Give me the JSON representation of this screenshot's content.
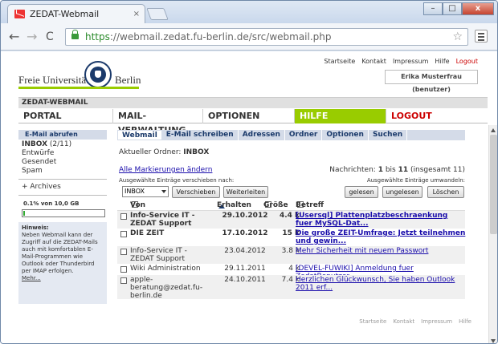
{
  "browser": {
    "tab_title": "ZEDAT-Webmail",
    "tab_close": "×",
    "url_https": "https",
    "url_rest": "://webmail.zedat.fu-berlin.de/src/webmail.php",
    "back": "←",
    "forward": "→",
    "reload": "C",
    "star": "☆",
    "min": "–",
    "max": "□",
    "close": "x"
  },
  "header": {
    "uni_left": "Freie Universität",
    "uni_right": "Berlin",
    "links": [
      "Startseite",
      "Kontakt",
      "Impressum",
      "Hilfe"
    ],
    "logout": "Logout",
    "user": "Erika Musterfrau (benutzer)",
    "strip": "ZEDAT-WEBMAIL"
  },
  "mainnav": [
    "PORTAL",
    "MAIL-VERWALTUNG",
    "OPTIONEN",
    "HILFE",
    "LOGOUT"
  ],
  "sidebar": {
    "head": "E-Mail abrufen",
    "inbox": "INBOX",
    "inbox_count": "(2/11)",
    "items": [
      "Entwürfe",
      "Gesendet",
      "Spam"
    ],
    "archives": "+ Archives",
    "quota": "0.1% von 10,0 GB",
    "quota_fraction": 0.001,
    "hint_title": "Hinweis:",
    "hint_text": "Neben Webmail kann der Zugriff auf die ZEDAT-Mails auch mit komfortablen E-Mail-Programmen wie Outlook oder Thunderbird per IMAP erfolgen.",
    "hint_more": "Mehr..."
  },
  "subnav": [
    "Webmail",
    "E-Mail schreiben",
    "Adressen",
    "Ordner",
    "Optionen",
    "Suchen"
  ],
  "folder": {
    "label": "Aktueller Ordner:",
    "name": "INBOX"
  },
  "toolbar": {
    "select_all": "Alle Markierungen ändern",
    "count_label": "Nachrichten:",
    "count_from": "1",
    "count_bis": "bis",
    "count_to": "11",
    "count_total": "(insgesamt 11)",
    "move_label": "Ausgewählte Einträge verschieben nach:",
    "transform_label": "Ausgewählte Einträge umwandeln:",
    "select_value": "INBOX",
    "btn_move": "Verschieben",
    "btn_forward": "Weiterleiten",
    "btn_read": "gelesen",
    "btn_unread": "ungelesen",
    "btn_delete": "Löschen"
  },
  "table": {
    "headers": [
      "Von",
      "Erhalten",
      "Größe",
      "Betreff"
    ],
    "rows": [
      {
        "from": "Info-Service IT - ZEDAT Support",
        "date": "29.10.2012",
        "size": "4.4 k",
        "subject": "[Usersql] Plattenplatzbeschraenkung fuer MySQL-Dat...",
        "unread": true
      },
      {
        "from": "DIE ZEIT",
        "date": "17.10.2012",
        "size": "15 k",
        "subject": "Die große ZEIT-Umfrage: Jetzt teilnehmen und gewin...",
        "unread": true
      },
      {
        "from": "Info-Service IT - ZEDAT Support",
        "date": "23.04.2012",
        "size": "3.8 k",
        "subject": "Mehr Sicherheit mit neuem Passwort",
        "unread": false
      },
      {
        "from": "Wiki Administration",
        "date": "29.11.2011",
        "size": "4 k",
        "subject": "[DEVEL-FUWIKI] Anmeldung fuer ZedatBenutzer",
        "unread": false
      },
      {
        "from": "apple-beratung@zedat.fu-berlin.de",
        "date": "24.10.2011",
        "size": "7.4 k",
        "subject": "Herzlichen Glückwunsch, Sie haben Outlook 2011 erf...",
        "unread": false
      }
    ]
  },
  "footer": [
    "Startseite",
    "Kontakt",
    "Impressum",
    "Hilfe"
  ]
}
